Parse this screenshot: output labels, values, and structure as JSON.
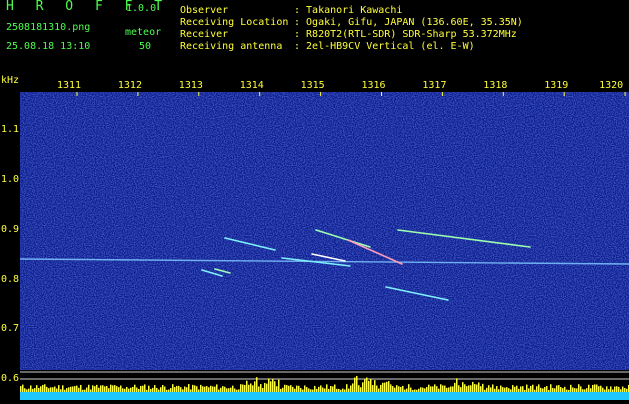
{
  "header": {
    "app_name": "H R O F F T",
    "version": "1.0.0",
    "filename": "2508181310.png",
    "datetime": "25.08.18 13:10",
    "event_label": "meteor",
    "event_value": "50",
    "fields": [
      {
        "label": "Observer",
        "value": ": Takanori Kawachi"
      },
      {
        "label": "Receiving Location",
        "value": ": Ogaki, Gifu, JAPAN (136.60E, 35.35N)"
      },
      {
        "label": "Receiver",
        "value": ": R820T2(RTL-SDR) SDR-Sharp 53.372MHz"
      },
      {
        "label": "Receiving antenna",
        "value": ": 2el-HB9CV Vertical (el. E-W)"
      }
    ]
  },
  "axes": {
    "y_unit": "kHz",
    "x_ticks": [
      "1311",
      "1312",
      "1313",
      "1314",
      "1315",
      "1316",
      "1317",
      "1318",
      "1319",
      "1320"
    ],
    "y_ticks": [
      "1.1",
      "1.0",
      "0.9",
      "0.8",
      "0.7",
      "0.6"
    ]
  },
  "colors": {
    "background": "#000000",
    "waterfall": "#0a1a8a",
    "carrier": "#7ec8ff",
    "spectrum": "#ffff3a",
    "spectrum_base": "#1ec8ff",
    "label_green": "#4cff4c",
    "label_yellow": "#ffff3a"
  }
}
